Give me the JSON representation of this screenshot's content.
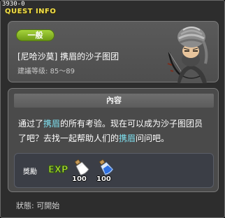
{
  "quest_id": "3930-0",
  "window_title": "QUEST INFO",
  "header": {
    "category": "一般",
    "quest_name": "[尼哈沙莫] 携眉的沙子图团",
    "level_label": "建議等级",
    "level_range": "85～89"
  },
  "content": {
    "section_title": "內容",
    "text_part1": "通过了",
    "highlight1": "携眉",
    "text_part2": "的所有考验。现在可以成为沙子图团员了吧？去找一起帮助人们的",
    "highlight2": "携眉",
    "text_part3": "问问吧。"
  },
  "reward": {
    "label": "獎勵",
    "items": [
      {
        "icon": "exp-icon",
        "label": "EXP"
      },
      {
        "icon": "white-potion-icon",
        "quantity": "100"
      },
      {
        "icon": "blue-potion-icon",
        "quantity": "100"
      }
    ]
  },
  "status": {
    "label": "狀態",
    "value": "可開始"
  },
  "colors": {
    "title": "#f2e14a",
    "category": "#8ab82a",
    "highlight": "#7fe0f0"
  }
}
